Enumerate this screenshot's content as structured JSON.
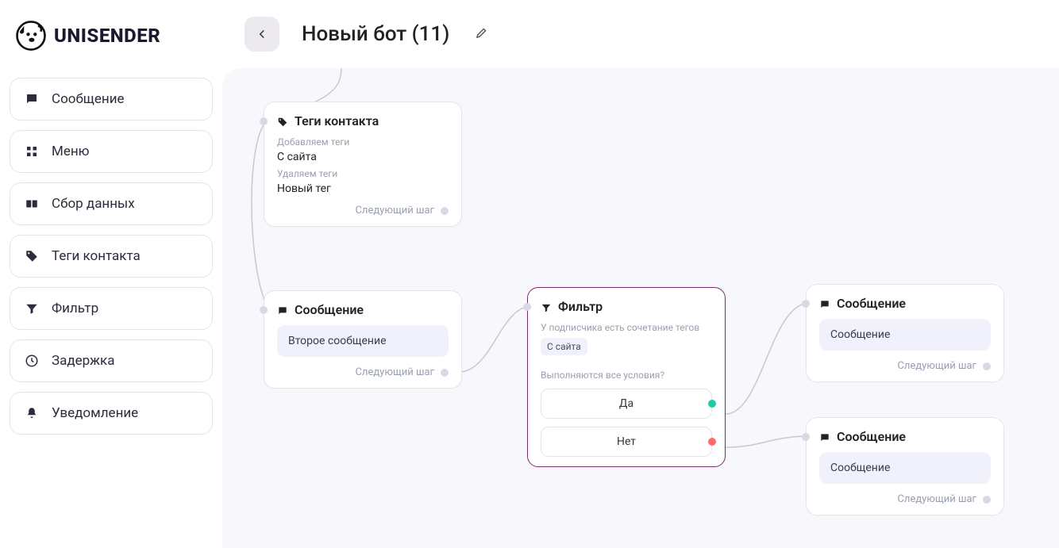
{
  "brand": "UNISENDER",
  "header": {
    "title": "Новый бот (11)"
  },
  "sidebar": [
    {
      "icon": "chat",
      "label": "Сообщение"
    },
    {
      "icon": "grid",
      "label": "Меню"
    },
    {
      "icon": "form",
      "label": "Сбор данных"
    },
    {
      "icon": "tag",
      "label": "Теги контакта"
    },
    {
      "icon": "filter",
      "label": "Фильтр"
    },
    {
      "icon": "clock",
      "label": "Задержка"
    },
    {
      "icon": "bell",
      "label": "Уведомление"
    }
  ],
  "nodes": {
    "tags": {
      "title": "Теги контакта",
      "add_label": "Добавляем теги",
      "add_value": "С сайта",
      "remove_label": "Удаляем теги",
      "remove_value": "Новый тег",
      "next": "Следующий шаг"
    },
    "msg2": {
      "title": "Сообщение",
      "body": "Второе сообщение",
      "next": "Следующий шаг"
    },
    "filter": {
      "title": "Фильтр",
      "cond_label": "У подписчика есть сочетание тегов",
      "cond_chip": "С сайта",
      "question": "Выполняются все условия?",
      "yes": "Да",
      "no": "Нет"
    },
    "msg_yes": {
      "title": "Сообщение",
      "body": "Сообщение",
      "next": "Следующий шаг"
    },
    "msg_no": {
      "title": "Сообщение",
      "body": "Сообщение",
      "next": "Следующий шаг"
    }
  }
}
